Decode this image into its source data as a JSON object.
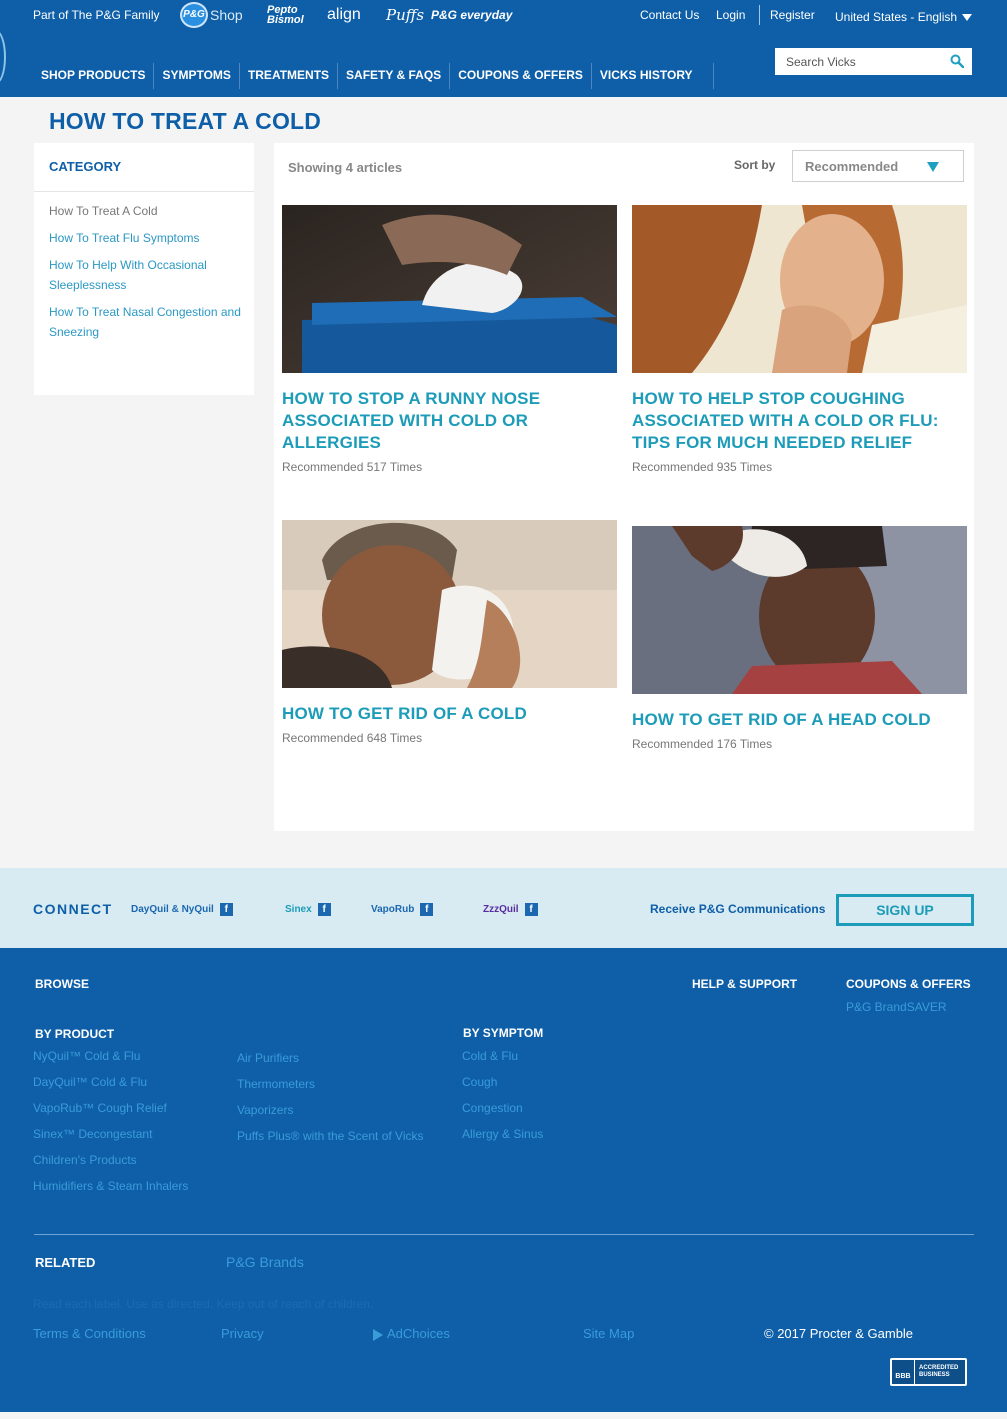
{
  "header": {
    "family_text": "Part of The P&G Family",
    "brands": {
      "pg_logo": "P&G",
      "pg_shop": "Shop",
      "pepto": "Pepto Bismol",
      "align": "align",
      "puffs": "Puffs",
      "everyday": "P&G everyday"
    },
    "contact": "Contact Us",
    "login": "Login",
    "register": "Register",
    "language": "United States - English",
    "nav": [
      "SHOP PRODUCTS",
      "SYMPTOMS",
      "TREATMENTS",
      "SAFETY & FAQS",
      "COUPONS & OFFERS",
      "VICKS HISTORY"
    ],
    "search_placeholder": "Search Vicks"
  },
  "page": {
    "title": "HOW TO TREAT A COLD"
  },
  "sidebar": {
    "title": "CATEGORY",
    "items": [
      {
        "label": "How To Treat A Cold",
        "current": true
      },
      {
        "label": "How To Treat Flu Symptoms",
        "current": false
      },
      {
        "label": "How To Help With Occasional Sleeplessness",
        "current": false
      },
      {
        "label": "How To Treat Nasal Congestion and Sneezing",
        "current": false
      }
    ]
  },
  "results": {
    "showing": "Showing 4 articles",
    "sort_label": "Sort by",
    "sort_value": "Recommended"
  },
  "articles": [
    {
      "title": "HOW TO STOP A RUNNY NOSE ASSOCIATED WITH COLD OR ALLERGIES",
      "meta": "Recommended 517 Times"
    },
    {
      "title": "HOW TO HELP STOP COUGHING ASSOCIATED WITH A COLD OR FLU: TIPS FOR MUCH NEEDED RELIEF",
      "meta": "Recommended 935 Times"
    },
    {
      "title": "HOW TO GET RID OF A COLD",
      "meta": "Recommended 648 Times"
    },
    {
      "title": "HOW TO GET RID OF A HEAD COLD",
      "meta": "Recommended 176 Times"
    }
  ],
  "connect": {
    "label": "CONNECT",
    "social": [
      "DayQuil & NyQuil",
      "Sinex",
      "VapoRub",
      "ZzzQuil"
    ],
    "fb": "f",
    "receive": "Receive P&G Communications",
    "signup": "SIGN UP"
  },
  "footer": {
    "browse": "BROWSE",
    "help": "HELP & SUPPORT",
    "coupons": "COUPONS & OFFERS",
    "brandsaver": "P&G BrandSAVER",
    "by_product": "BY PRODUCT",
    "products_col1": [
      "NyQuil™ Cold & Flu",
      "DayQuil™ Cold & Flu",
      "VapoRub™ Cough Relief",
      "Sinex™ Decongestant",
      "Children's Products",
      "Humidifiers & Steam Inhalers"
    ],
    "products_col2": [
      "Air Purifiers",
      "Thermometers",
      "Vaporizers",
      "Puffs Plus® with the Scent of Vicks"
    ],
    "by_symptom": "BY SYMPTOM",
    "symptoms": [
      "Cold & Flu",
      "Cough",
      "Congestion",
      "Allergy & Sinus"
    ],
    "related": "RELATED",
    "pg_brands": "P&G Brands",
    "disclaimer": "Read each label. Use as directed. Keep out of reach of children.",
    "terms": "Terms & Conditions",
    "privacy": "Privacy",
    "adchoices": "AdChoices",
    "sitemap": "Site Map",
    "copyright": "© 2017 Procter & Gamble",
    "bbb_seal": "BBB",
    "bbb_text": "ACCREDITED BUSINESS"
  }
}
